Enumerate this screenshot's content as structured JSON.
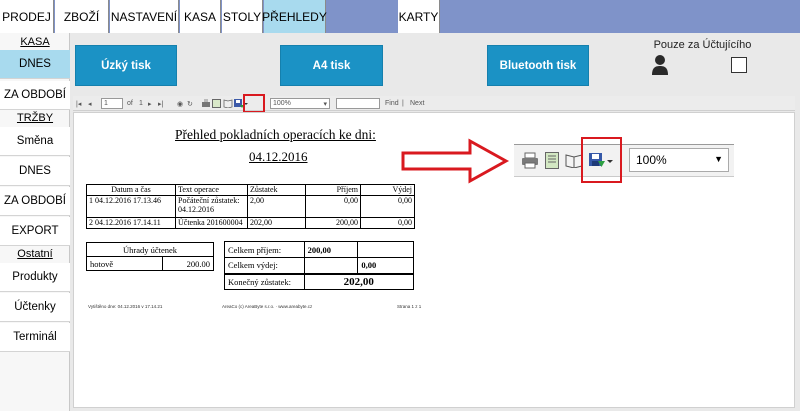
{
  "nav": {
    "tabs": [
      "PRODEJ",
      "ZBOŽÍ",
      "NASTAVENÍ",
      "KASA",
      "STOLY",
      "PŘEHLEDY",
      "KARTY"
    ]
  },
  "sidebar": {
    "kasa_header": "KASA",
    "kasa_items": [
      "DNES",
      "ZA OBDOBÍ"
    ],
    "trzby_header": "TRŽBY",
    "trzby_items": [
      "Směna",
      "DNES",
      "ZA OBDOBÍ",
      "EXPORT"
    ],
    "ostatni_header": "Ostatní",
    "ostatni_items": [
      "Produkty",
      "Účtenky",
      "Terminál"
    ]
  },
  "buttons": {
    "uzky": "Úzký tisk",
    "a4": "A4 tisk",
    "bluetooth": "Bluetooth tisk"
  },
  "pouze": "Pouze za Účtujícího",
  "viewer": {
    "page_current": "1",
    "page_of": "of",
    "page_total": "1",
    "zoom": "100%",
    "find": "Find",
    "next": "Next"
  },
  "report": {
    "title": "Přehled pokladních operacích ke dni:",
    "date": "04.12.2016",
    "columns": [
      "Datum a čas",
      "Text operace",
      "Zůstatek",
      "Příjem",
      "Výdej"
    ],
    "rows": [
      {
        "n": "1",
        "datetime": "04.12.2016 17.13.46",
        "text": "Počáteční zůstatek: 04.12.2016",
        "balance": "2,00",
        "income": "0,00",
        "expense": "0,00"
      },
      {
        "n": "2",
        "datetime": "04.12.2016 17.14.11",
        "text": "Účtenka 201600004",
        "balance": "202,00",
        "income": "200,00",
        "expense": "0,00"
      }
    ],
    "uhrady_title": "Úhrady účtenek",
    "uhrady_method": "hotově",
    "uhrady_value": "200.00",
    "celkem_prijem_label": "Celkem příjem:",
    "celkem_prijem": "200,00",
    "celkem_vydej_label": "Celkem výdej:",
    "celkem_vydej": "0,00",
    "konecny_label": "Konečný zůstatek:",
    "konecny": "202,00",
    "footer_left": "Vytištěno dne: 04.12.2016 v 17.14.21",
    "footer_mid": "AreaCo (c) AreaByte s.r.o. · www.areabyte.cz",
    "footer_right": "Strana 1 z 1"
  },
  "zoom_panel": {
    "zoom": "100%"
  },
  "colors": {
    "nav_bg": "#7f93c9",
    "active_tab": "#a8daee",
    "button": "#1b92c5",
    "annotation_red": "#d9191f"
  }
}
